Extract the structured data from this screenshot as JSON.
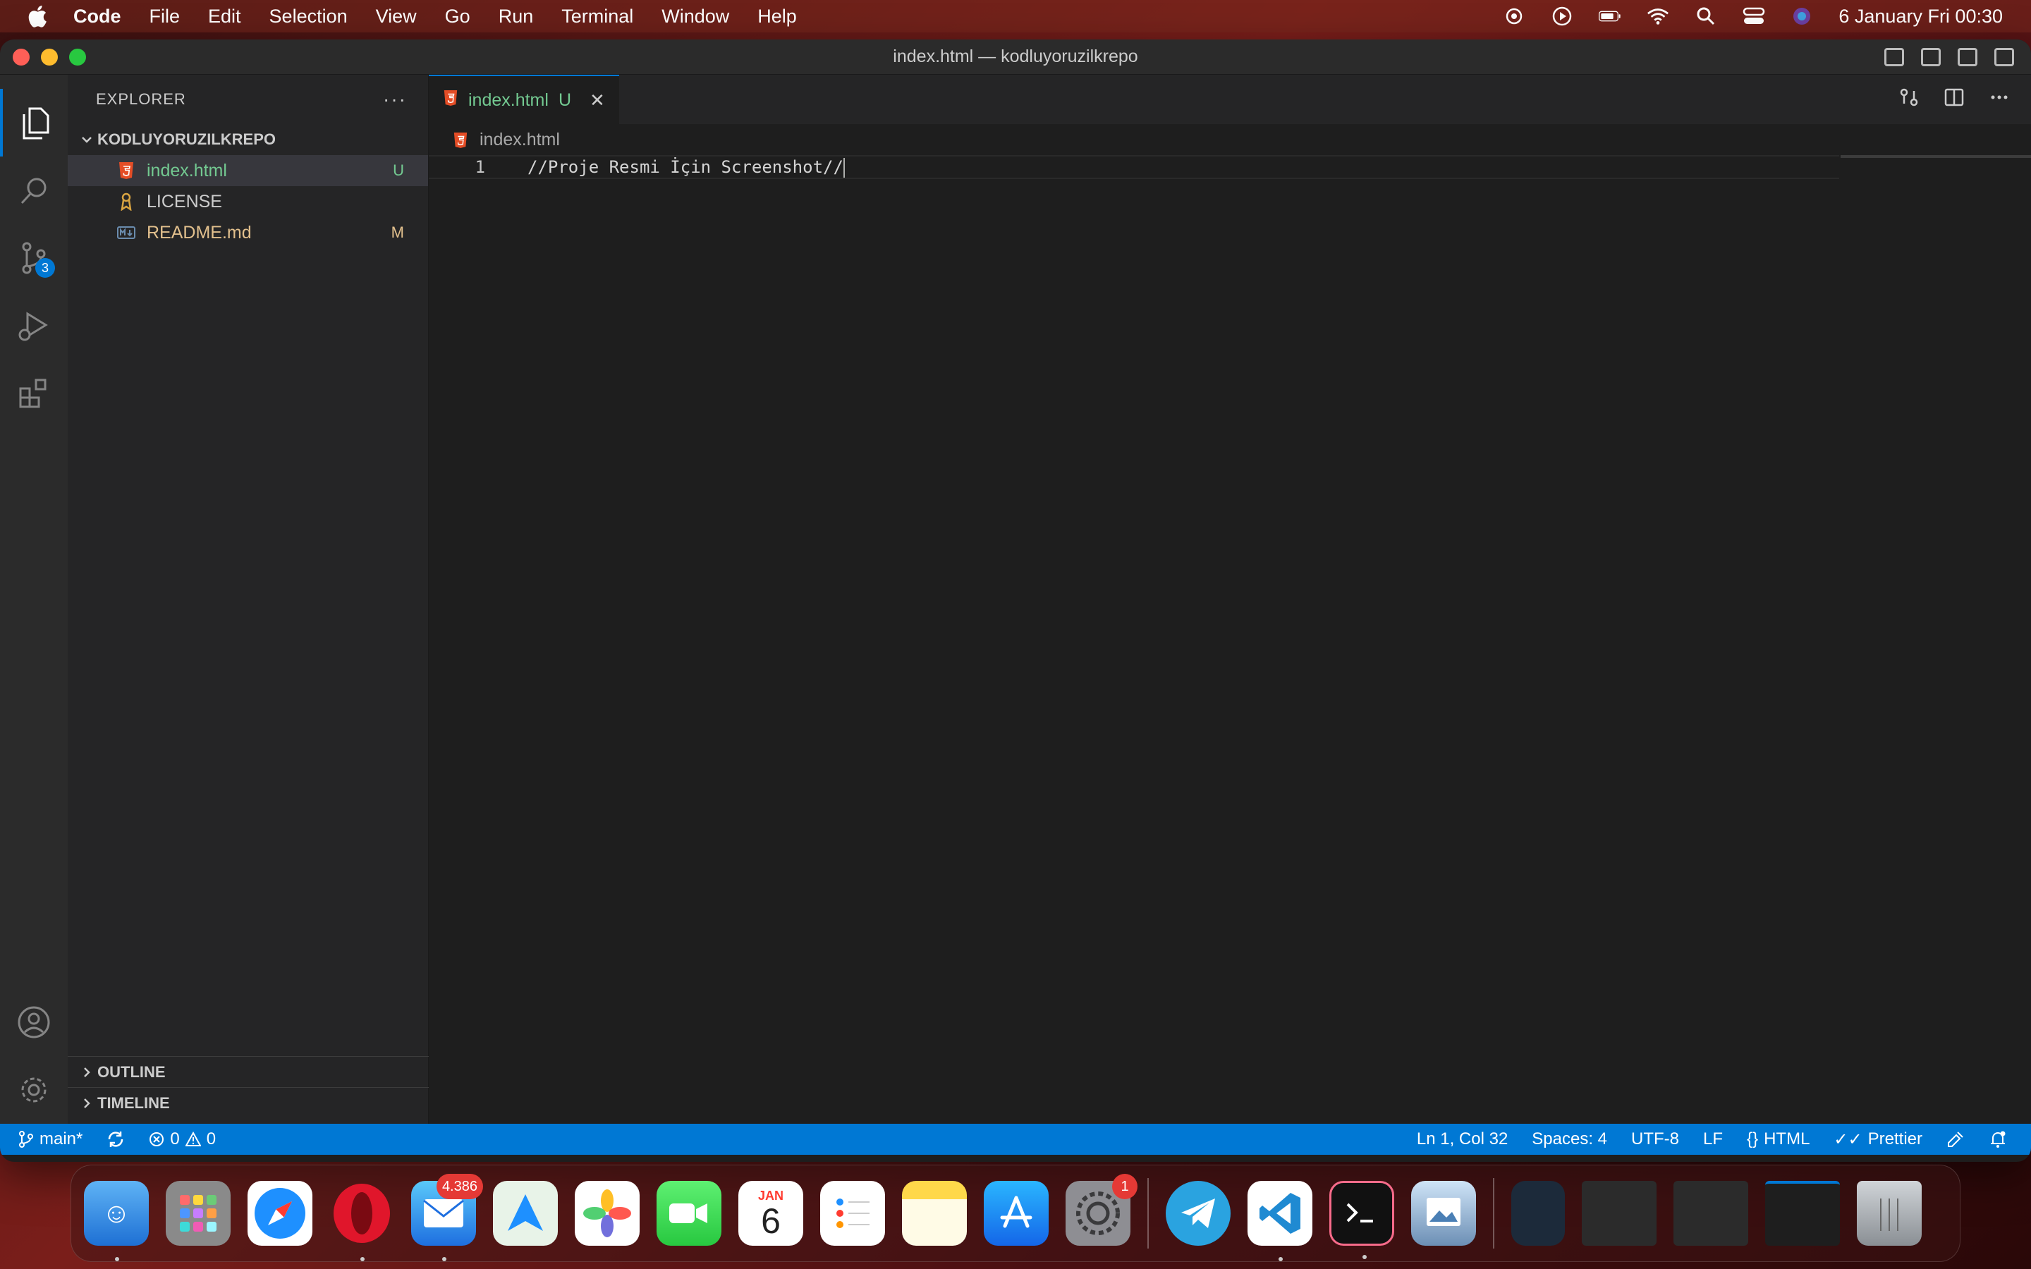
{
  "menubar": {
    "app_name": "Code",
    "items": [
      "File",
      "Edit",
      "Selection",
      "View",
      "Go",
      "Run",
      "Terminal",
      "Window",
      "Help"
    ],
    "clock": "6 January Fri  00:30"
  },
  "window": {
    "title": "index.html — kodluyoruzilkrepo"
  },
  "activitybar": {
    "source_control_badge": "3"
  },
  "sidebar": {
    "header": "EXPLORER",
    "more": "···",
    "folder": "KODLUYORUZILKREPO",
    "files": [
      {
        "name": "index.html",
        "status": "U"
      },
      {
        "name": "LICENSE",
        "status": ""
      },
      {
        "name": "README.md",
        "status": "M"
      }
    ],
    "outline": "OUTLINE",
    "timeline": "TIMELINE"
  },
  "editor": {
    "tab": {
      "label": "index.html",
      "status": "U",
      "close": "✕"
    },
    "breadcrumb": "index.html",
    "lines": [
      {
        "number": "1",
        "text": "//Proje Resmi İçin Screenshot//"
      }
    ]
  },
  "statusbar": {
    "branch": "main*",
    "errors": "0",
    "warnings": "0",
    "position": "Ln 1, Col 32",
    "spaces": "Spaces: 4",
    "encoding": "UTF-8",
    "eol": "LF",
    "language": "HTML",
    "formatter": "Prettier"
  },
  "dock": {
    "mail_badge": "4.386",
    "settings_badge": "1",
    "calendar_month": "JAN",
    "calendar_day": "6"
  }
}
